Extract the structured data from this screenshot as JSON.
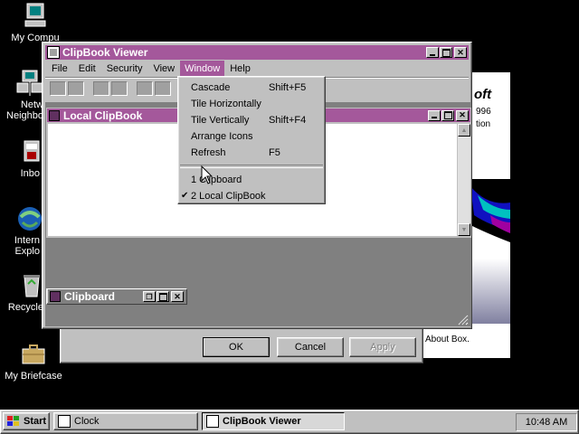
{
  "desktop": {
    "icons": [
      {
        "label": "My Computer",
        "icon": "computer-icon"
      },
      {
        "label": "Network Neighborhood",
        "icon": "network-icon"
      },
      {
        "label": "Inbox",
        "icon": "inbox-icon"
      },
      {
        "label": "Internet Explorer",
        "icon": "ie-icon"
      },
      {
        "label": "Recycle Bin",
        "icon": "recycle-bin-icon"
      },
      {
        "label": "My Briefcase",
        "icon": "briefcase-icon"
      }
    ],
    "icon_labels_visible": {
      "my_computer": "My Compu",
      "network_line1": "Netw",
      "network_line2": "Neighbo",
      "inbox": "Inbo",
      "ie_line1": "Intern",
      "ie_line2": "Explo",
      "recycle": "Recycle",
      "briefcase": "My Briefcase"
    }
  },
  "background_dialog": {
    "ok_label": "OK",
    "cancel_label": "Cancel",
    "apply_label": "Apply",
    "brand_fragment": "oft",
    "year_fragment": "996",
    "version_fragment": "tion",
    "about_text": "About Box."
  },
  "clipbook_window": {
    "title": "ClipBook Viewer",
    "menu": [
      "File",
      "Edit",
      "Security",
      "View",
      "Window",
      "Help"
    ],
    "active_menu": "Window"
  },
  "window_menu": {
    "items": [
      {
        "label": "Cascade",
        "accel": "Shift+F5"
      },
      {
        "label": "Tile Horizontally",
        "accel": ""
      },
      {
        "label": "Tile Vertically",
        "accel": "Shift+F4"
      },
      {
        "label": "Arrange Icons",
        "accel": ""
      },
      {
        "label": "Refresh",
        "accel": "F5"
      }
    ],
    "window_list": [
      {
        "label": "1 Clipboard",
        "checked": false
      },
      {
        "label": "2 Local ClipBook",
        "checked": true
      }
    ],
    "check_mark": "✔"
  },
  "local_clipbook": {
    "title": "Local ClipBook"
  },
  "clipboard_min": {
    "title": "Clipboard"
  },
  "taskbar": {
    "start_label": "Start",
    "tasks": [
      {
        "label": "Clock",
        "active": false
      },
      {
        "label": "ClipBook Viewer",
        "active": true
      }
    ],
    "clock": "10:48 AM"
  },
  "colors": {
    "title_active": "#a4589b",
    "face": "#c0c0c0",
    "desktop": "#000000"
  }
}
